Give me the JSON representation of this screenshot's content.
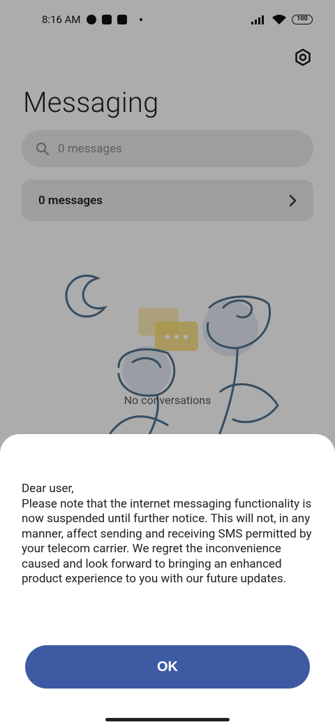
{
  "status_bar": {
    "time": "8:16 AM",
    "battery": "100"
  },
  "page": {
    "title": "Messaging"
  },
  "search": {
    "placeholder": "0 messages"
  },
  "summary": {
    "label": "0 messages"
  },
  "empty_state": {
    "text": "No conversations"
  },
  "dialog": {
    "message": "Dear user,\nPlease note that the internet messaging functionality is now suspended until further notice. This will not, in any manner, affect sending and receiving SMS permitted by your telecom carrier. We regret the inconvenience caused and look forward to bringing an enhanced product experience to you with our future updates.",
    "ok_label": "OK"
  },
  "colors": {
    "accent": "#3d5aa3",
    "illustration_line": "#4d6f8d",
    "bubble_yellow": "#f3d46a"
  }
}
